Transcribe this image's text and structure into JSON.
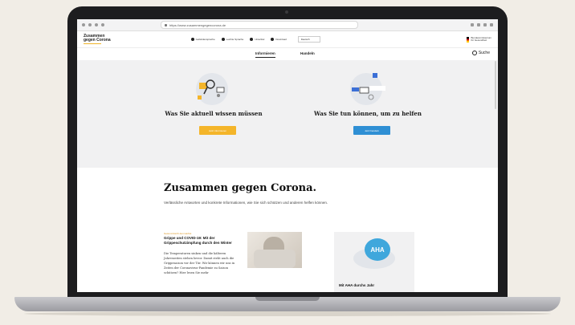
{
  "browser": {
    "url": "https://www.zusammengegencorona.de"
  },
  "header": {
    "logo_line1": "Zusammen",
    "logo_line2": "gegen Corona",
    "meta_nav": [
      {
        "label": "Gebärdensprache",
        "icon": "sign-language-icon"
      },
      {
        "label": "Leichte Sprache",
        "icon": "easy-language-icon"
      },
      {
        "label": "Untertitel",
        "icon": "subtitles-icon"
      },
      {
        "label": "Download",
        "icon": "download-icon"
      }
    ],
    "language": "Deutsch",
    "ministry_line1": "Bundesministerium",
    "ministry_line2": "für Gesundheit"
  },
  "nav": {
    "tabs": [
      "Informieren",
      "Handeln"
    ],
    "search_label": "Suche"
  },
  "hero": {
    "left_title": "Was Sie aktuell wissen müssen",
    "left_button": "Jetzt informieren",
    "right_title": "Was Sie tun können, um zu helfen",
    "right_button": "Jetzt handeln"
  },
  "intro": {
    "title": "Zusammen gegen Corona.",
    "text": "Verlässliche Antworten und konkrete Informationen, wie Sie sich schützen und anderen helfen können."
  },
  "card_left": {
    "kicker": "Gesund durch den Herbst",
    "title": "Grippe und COVID-19: Mit der Grippeschutzimpfung durch den Winter",
    "text": "Die Temperaturen sinken und die kälteren Jahreszeiten stehen bevor. Damit steht auch die Grippesaison vor der Tür. Wir können wir uns in Zeiten der Coronavirus-Pandemie zu Saison schützen? Hier lesen Sie mehr"
  },
  "card_right": {
    "badge": "AHA",
    "title": "Mit AHA durchs Jahr"
  },
  "colors": {
    "accent_yellow": "#f4b52a",
    "accent_blue": "#2f8fd4",
    "hero_bg": "#f1f1f2",
    "laptop_frame": "#1d1d1f"
  }
}
